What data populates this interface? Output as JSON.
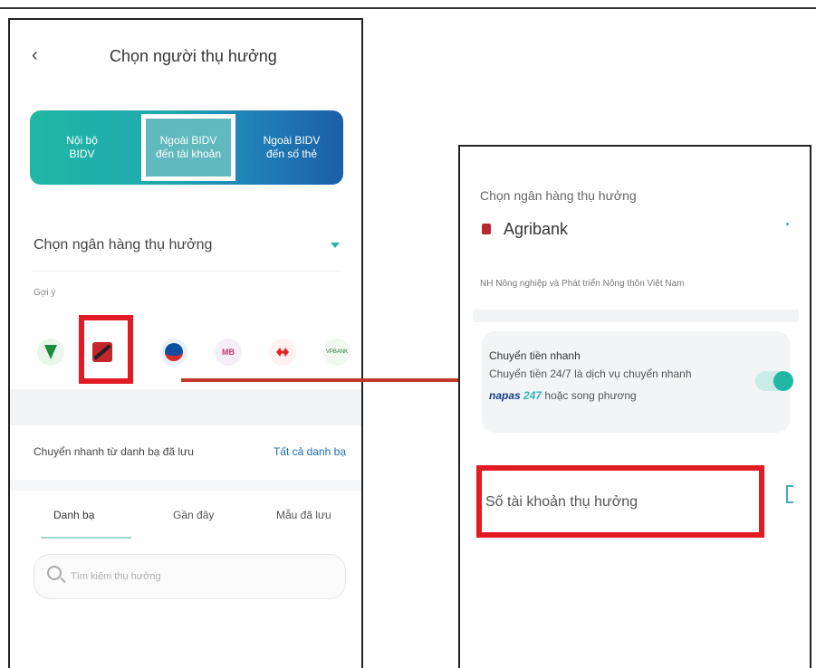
{
  "left_screen": {
    "title": "Chọn người thụ hưởng",
    "tabs_top": [
      {
        "label": "Nội bộ\nBIDV"
      },
      {
        "label": "Ngoài BIDV\nđến tài khoản"
      },
      {
        "label": "Ngoài BIDV\nđến số thẻ"
      }
    ],
    "bank_select_label": "Chọn ngân hàng thụ hưởng",
    "suggest_label": "Gợi ý",
    "bank_icons": [
      {
        "icon": "vietcombank-icon"
      },
      {
        "icon": "agribank-icon"
      },
      {
        "icon": "vietinbank-icon"
      },
      {
        "icon": "mb-icon",
        "text": "MB"
      },
      {
        "icon": "techcombank-icon"
      },
      {
        "icon": "vpbank-icon",
        "text": "VPBANK"
      }
    ],
    "contacts_label": "Chuyển nhanh từ danh bạ đã lưu",
    "contacts_link": "Tất cả danh bạ",
    "tabs_bottom": [
      "Danh bạ",
      "Gần đây",
      "Mẫu đã lưu"
    ],
    "search_placeholder": "Tìm kiếm thụ hưởng"
  },
  "right_screen": {
    "bank_label": "Chọn ngân hàng thụ hưởng",
    "bank_name": "Agribank",
    "bank_full_name": "NH Nông nghiệp và Phát triển Nông thôn Việt Nam",
    "fast_transfer": {
      "title": "Chuyển tiền nhanh",
      "desc_line1": "Chuyển tiền 24/7 là dịch vụ chuyển nhanh",
      "napas": "napas",
      "napas_247": "247",
      "desc_line2_suffix": "hoặc song phương",
      "toggle_on": true
    },
    "account_label": "Số tài khoản thụ hưởng"
  },
  "colors": {
    "accent_teal": "#1fb7a3",
    "highlight_red": "#e21a23",
    "arrow_red": "#c0392b",
    "link_blue": "#1b6fb5"
  }
}
